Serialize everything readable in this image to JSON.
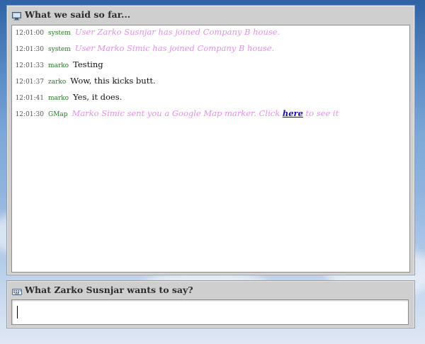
{
  "chat_panel": {
    "title": "What we said so far...",
    "icon": "monitor-icon",
    "messages": [
      {
        "time": "12:01:00",
        "user": "system",
        "text": "User Zarko Susnjar has joined Company B house.",
        "type": "system"
      },
      {
        "time": "12:01:30",
        "user": "system",
        "text": "User Marko Simic has joined Company B house.",
        "type": "system"
      },
      {
        "time": "12:01:33",
        "user": "marko",
        "text": "Testing",
        "type": "user"
      },
      {
        "time": "12:01:37",
        "user": "zarko",
        "text": "Wow, this kicks butt.",
        "type": "user"
      },
      {
        "time": "12:01:41",
        "user": "marko",
        "text": "Yes, it does.",
        "type": "user"
      },
      {
        "time": "12:01:30",
        "user": "GMap",
        "text_before": "Marko Simic sent you a Google Map marker. Click ",
        "link": "here",
        "text_after": " to see it",
        "type": "system-link"
      }
    ]
  },
  "input_panel": {
    "title": "What Zarko Susnjar wants to say?",
    "icon": "keyboard-icon",
    "value": ""
  },
  "colors": {
    "system_text": "#e38fe9",
    "username": "#1f7a1f",
    "link": "#1a0dab",
    "panel_bg": "#cfcfcf"
  }
}
